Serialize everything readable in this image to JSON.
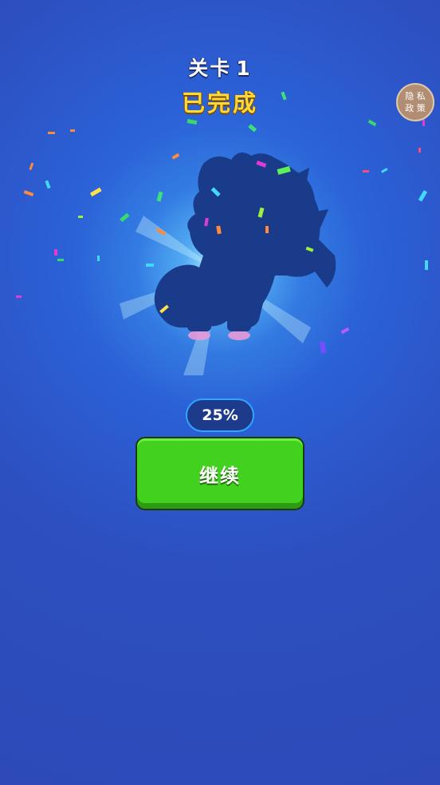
{
  "header": {
    "level_prefix": "关卡",
    "level_number": "1",
    "status": "已完成"
  },
  "privacy_button": {
    "line1": "隐 私",
    "line2": "政 策"
  },
  "progress": {
    "label": "25%",
    "value": 0.25
  },
  "continue_button": {
    "label": "继续"
  },
  "colors": {
    "background": "#2d4ab8",
    "title_yellow": "#ffd83a",
    "button_green": "#43d11f",
    "silhouette": "#1a3a8a",
    "pill_border": "#2fa6ff"
  },
  "icons": {
    "character": "character-silhouette-icon"
  }
}
